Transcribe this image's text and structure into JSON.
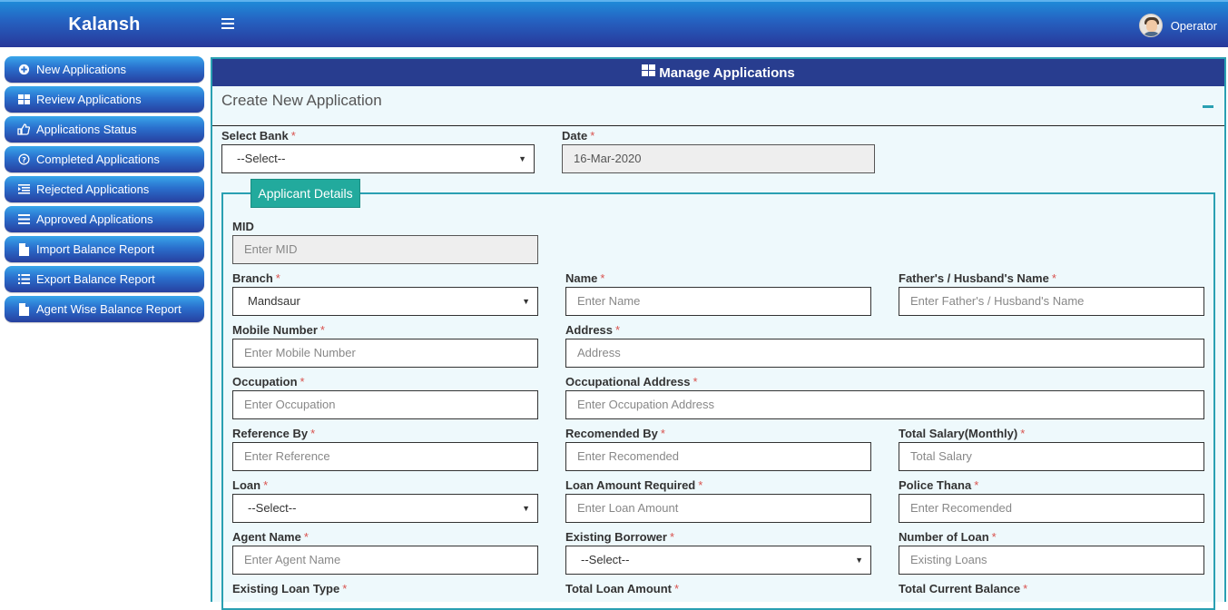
{
  "app": {
    "brand": "Kalansh",
    "user": "Operator"
  },
  "sidebar": {
    "items": [
      {
        "label": "New Applications",
        "icon": "plus-circle-icon"
      },
      {
        "label": "Review Applications",
        "icon": "grid-icon"
      },
      {
        "label": "Applications Status",
        "icon": "thumbs-up-icon"
      },
      {
        "label": "Completed Applications",
        "icon": "question-circle-icon"
      },
      {
        "label": "Rejected Applications",
        "icon": "list-indent-icon"
      },
      {
        "label": "Approved Applications",
        "icon": "bars-icon"
      },
      {
        "label": "Import Balance Report",
        "icon": "file-icon"
      },
      {
        "label": "Export Balance Report",
        "icon": "list-icon"
      },
      {
        "label": "Agent Wise Balance Report",
        "icon": "file-icon"
      }
    ]
  },
  "panel": {
    "title": "Manage Applications",
    "subtitle": "Create New Application"
  },
  "colors": {
    "accent": "#2aa0b2",
    "header": "#283d8f",
    "legend": "#22aa9d",
    "required": "#d9534f"
  },
  "form": {
    "bank": {
      "label": "Select Bank",
      "value": "--Select--"
    },
    "date": {
      "label": "Date",
      "value": "16-Mar-2020"
    },
    "section": "Applicant Details",
    "mid": {
      "label": "MID",
      "placeholder": "Enter MID"
    },
    "branch": {
      "label": "Branch",
      "value": "Mandsaur"
    },
    "name": {
      "label": "Name",
      "placeholder": "Enter Name"
    },
    "father": {
      "label": "Father's / Husband's Name",
      "placeholder": "Enter Father's / Husband's Name"
    },
    "mobile": {
      "label": "Mobile Number",
      "placeholder": "Enter Mobile Number"
    },
    "address": {
      "label": "Address",
      "placeholder": "Address"
    },
    "occupation": {
      "label": "Occupation",
      "placeholder": "Enter Occupation"
    },
    "occ_address": {
      "label": "Occupational Address",
      "placeholder": "Enter Occupation Address"
    },
    "reference": {
      "label": "Reference By",
      "placeholder": "Enter Reference"
    },
    "recomended": {
      "label": "Recomended By",
      "placeholder": "Enter Recomended"
    },
    "salary": {
      "label": "Total Salary(Monthly)",
      "placeholder": "Total Salary"
    },
    "loan": {
      "label": "Loan",
      "value": "--Select--"
    },
    "loan_amount": {
      "label": "Loan Amount Required",
      "placeholder": "Enter Loan Amount"
    },
    "police": {
      "label": "Police Thana",
      "placeholder": "Enter Recomended"
    },
    "agent": {
      "label": "Agent Name",
      "placeholder": "Enter Agent Name"
    },
    "borrower": {
      "label": "Existing Borrower",
      "value": "--Select--"
    },
    "num_loan": {
      "label": "Number of Loan",
      "placeholder": "Existing Loans"
    },
    "loan_type": {
      "label": "Existing Loan Type"
    },
    "total_loan": {
      "label": "Total Loan Amount"
    },
    "balance": {
      "label": "Total Current Balance"
    }
  }
}
